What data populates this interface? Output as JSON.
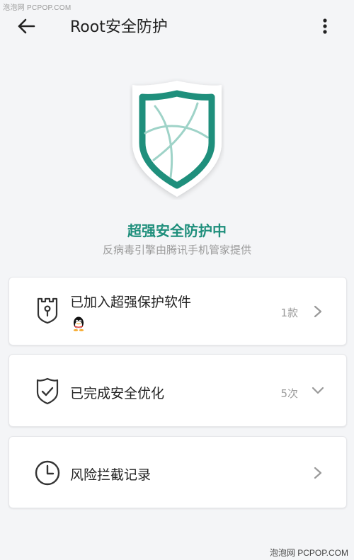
{
  "watermark_top": "泡泡网 PCPOP.COM",
  "watermark_bottom": "泡泡网 PCPOP.COM",
  "header": {
    "title": "Root安全防护",
    "back_icon": "arrow-left-icon",
    "more_icon": "more-vertical-icon"
  },
  "status": {
    "title": "超强安全防护中",
    "subtitle": "反病毒引擎由腾讯手机管家提供"
  },
  "cards": [
    {
      "label": "已加入超强保护软件",
      "count": "1款",
      "icon": "tower-lock-icon",
      "chevron": "chevron-right-icon",
      "app_icon": "qq-penguin-icon"
    },
    {
      "label": "已完成安全优化",
      "count": "5次",
      "icon": "shield-check-icon",
      "chevron": "chevron-down-icon"
    },
    {
      "label": "风险拦截记录",
      "count": "",
      "icon": "clock-icon",
      "chevron": "chevron-right-icon"
    }
  ],
  "colors": {
    "accent": "#1f8f7c",
    "background": "#f4f5f7",
    "card": "#ffffff",
    "muted": "#9b9b9b"
  }
}
